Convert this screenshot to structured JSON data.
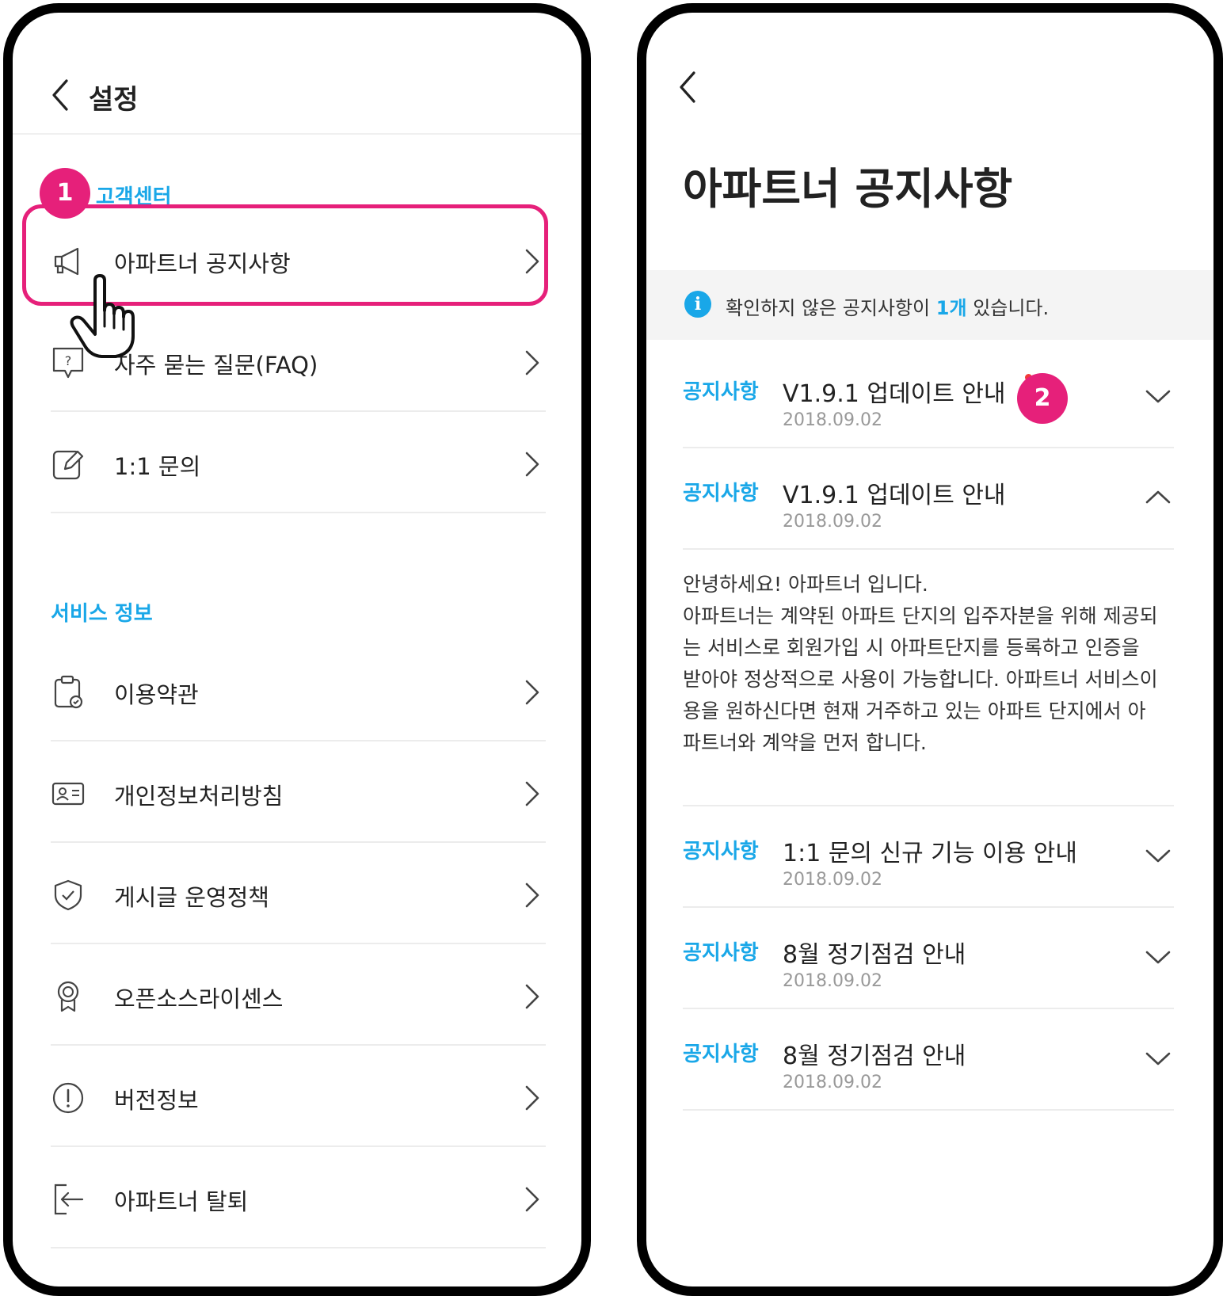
{
  "left": {
    "header": {
      "title": "설정"
    },
    "customer_center": {
      "label": "트너 고객센터",
      "items": [
        {
          "label": "아파트너 공지사항",
          "icon": "megaphone-icon"
        },
        {
          "label": "자주 묻는 질문(FAQ)",
          "icon": "question-bubble-icon"
        },
        {
          "label": "1:1 문의",
          "icon": "edit-icon"
        }
      ]
    },
    "service_info": {
      "label": "서비스 정보",
      "items": [
        {
          "label": "이용약관",
          "icon": "clipboard-check-icon"
        },
        {
          "label": "개인정보처리방침",
          "icon": "id-card-icon"
        },
        {
          "label": "게시글 운영정책",
          "icon": "shield-check-icon"
        },
        {
          "label": "오픈소스라이센스",
          "icon": "award-icon"
        },
        {
          "label": "버전정보",
          "icon": "info-circle-icon"
        },
        {
          "label": "아파트너 탈퇴",
          "icon": "exit-icon"
        }
      ]
    },
    "step_badge": "1"
  },
  "right": {
    "title": "아파트너 공지사항",
    "banner": {
      "prefix": "확인하지 않은 공지사항이 ",
      "count": "1개",
      "suffix": " 있습니다."
    },
    "step_badge": "2",
    "notices": [
      {
        "category": "공지사항",
        "title": "V1.9.1 업데이트 안내",
        "date": "2018.09.02",
        "expanded": false,
        "unread": true
      },
      {
        "category": "공지사항",
        "title": "V1.9.1 업데이트 안내",
        "date": "2018.09.02",
        "expanded": true,
        "unread": false
      },
      {
        "category": "공지사항",
        "title": "1:1 문의 신규 기능 이용 안내",
        "date": "2018.09.02",
        "expanded": false,
        "unread": false
      },
      {
        "category": "공지사항",
        "title": "8월 정기점검 안내",
        "date": "2018.09.02",
        "expanded": false,
        "unread": false
      },
      {
        "category": "공지사항",
        "title": "8월 정기점검 안내",
        "date": "2018.09.02",
        "expanded": false,
        "unread": false
      }
    ],
    "expanded_content": [
      "안녕하세요! 아파트너 입니다.",
      "아파트너는 계약된 아파트 단지의 입주자분을 위해 제공되",
      "는 서비스로 회원가입 시 아파트단지를 등록하고 인증을",
      "받아야 정상적으로 사용이 가능합니다. 아파트너 서비스이",
      "용을 원하신다면 현재 거주하고 있는 아파트 단지에서 아",
      "파트너와 계약을 먼저 합니다."
    ]
  },
  "colors": {
    "accent": "#19a7e8",
    "highlight": "#e6207a",
    "unread_dot": "#f23a3a"
  }
}
